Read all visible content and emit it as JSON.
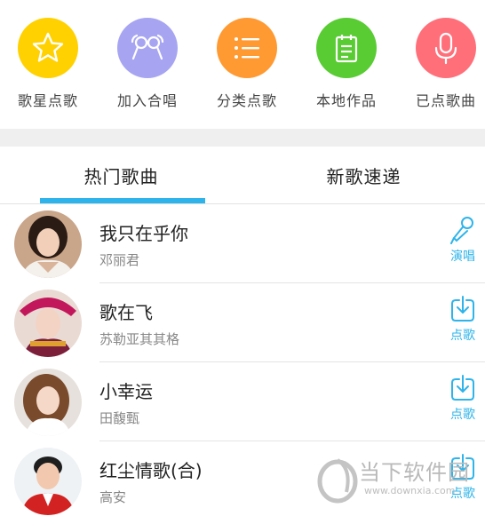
{
  "shortcuts": [
    {
      "label": "歌星点歌",
      "icon": "star-icon",
      "color": "#FFD100"
    },
    {
      "label": "加入合唱",
      "icon": "chorus-mics-icon",
      "color": "#A7A5F2"
    },
    {
      "label": "分类点歌",
      "icon": "list-icon",
      "color": "#FF9A33"
    },
    {
      "label": "本地作品",
      "icon": "notebook-icon",
      "color": "#59CC33"
    },
    {
      "label": "已点歌曲",
      "icon": "microphone-icon",
      "color": "#FF6F7A"
    }
  ],
  "tabs": [
    {
      "label": "热门歌曲",
      "active": true
    },
    {
      "label": "新歌速递",
      "active": false
    }
  ],
  "accent_color": "#2EB4EA",
  "songs": [
    {
      "title": "我只在乎你",
      "artist": "邓丽君",
      "action": "演唱",
      "action_icon": "microphone-icon"
    },
    {
      "title": "歌在飞",
      "artist": "苏勒亚其其格",
      "action": "点歌",
      "action_icon": "download-icon"
    },
    {
      "title": "小幸运",
      "artist": "田馥甄",
      "action": "点歌",
      "action_icon": "download-icon"
    },
    {
      "title": "红尘情歌(合)",
      "artist": "高安",
      "action": "点歌",
      "action_icon": "download-icon"
    }
  ],
  "watermark": {
    "name": "当下软件园",
    "url": "www.downxia.com"
  }
}
